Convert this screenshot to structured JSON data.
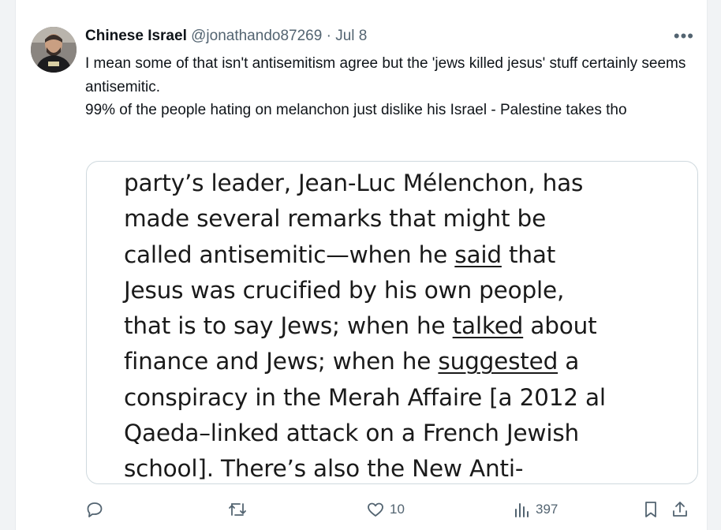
{
  "tweet": {
    "display_name": "Chinese Israel",
    "handle": "@jonathando87269",
    "separator": "·",
    "date": "Jul 8",
    "more_label": "•••",
    "text_lines": [
      "I mean some of that isn't antisemitism agree but the 'jews killed jesus' stuff certainly seems antisemitic.",
      "99% of the people hating on melanchon just dislike his Israel - Palestine takes tho"
    ]
  },
  "media": {
    "lines": [
      "party’s leader, Jean-Luc Mélenchon, has",
      "made several remarks that might be",
      "called antisemitic—when he ",
      "said",
      " that",
      "Jesus was crucified by his own people,",
      "that is to say Jews; when he ",
      "talked",
      " about",
      "finance and Jews; when he ",
      "suggested",
      " a",
      "conspiracy in the Merah Affaire [a 2012 al",
      "Qaeda–linked attack on a French Jewish",
      "school]. There’s also the New Anti-"
    ]
  },
  "actions": {
    "reply_count": "",
    "retweet_count": "",
    "like_count": "10",
    "views_count": "397"
  },
  "icons": [
    "reply-icon",
    "retweet-icon",
    "like-icon",
    "views-icon",
    "bookmark-icon",
    "share-icon"
  ],
  "colors": {
    "text": "#0f1419",
    "muted": "#536471",
    "border": "#cfd9de"
  }
}
